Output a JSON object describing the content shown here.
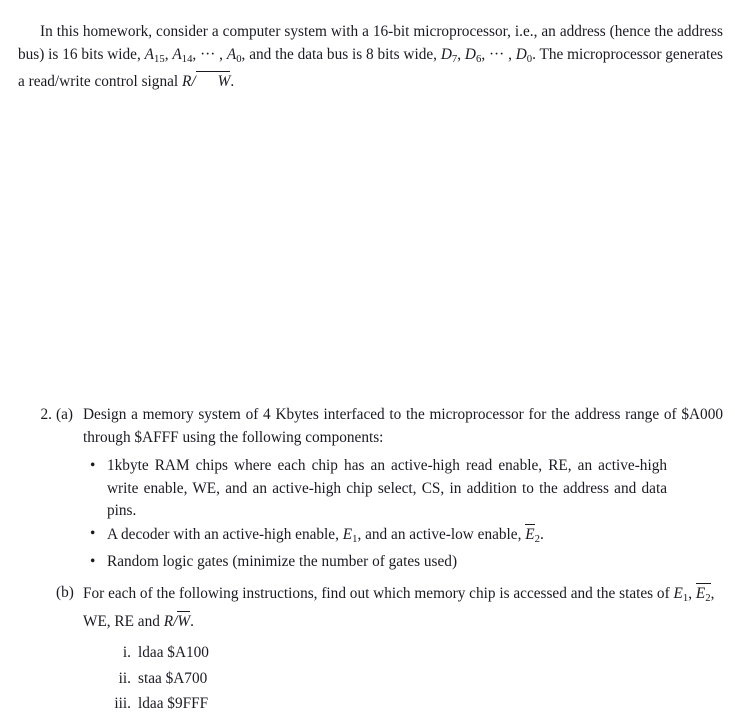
{
  "document": {
    "intro": {
      "text_plain": "In this homework, consider a computer system with a 16-bit microprocessor, i.e., an address (hence the address bus) is 16 bits wide, A15, A14, ···, A0, and the data bus is 8 bits wide, D7, D6, ···, D0. The microprocessor generates a read/write control signal R/W̄.",
      "seg1": "In this homework, consider a computer system with a 16-bit microprocessor, i.e., an address (hence the address bus) is 16 bits wide, ",
      "addr_msb": "A",
      "addr_msb_sub": "15",
      "comma1": ", ",
      "addr_next": "A",
      "addr_next_sub": "14",
      "ellipsis1": ", ··· , ",
      "addr_lsb": "A",
      "addr_lsb_sub": "0",
      "seg2": ", and the data bus is 8 bits wide, ",
      "data_msb": "D",
      "data_msb_sub": "7",
      "comma2": ", ",
      "data_next": "D",
      "data_next_sub": "6",
      "ellipsis2": ", ··· , ",
      "data_lsb": "D",
      "data_lsb_sub": "0",
      "seg3": ". The microprocessor generates a read/write control signal ",
      "rw_r": "R",
      "rw_slash": "/",
      "rw_w": "W",
      "period": "."
    },
    "problem": {
      "number": "2.",
      "parts": [
        {
          "label": "(a)",
          "text": "Design a memory system of 4 Kbytes interfaced to the microprocessor for the address range of $A000 through $AFFF using the following components:",
          "bullets": [
            {
              "marker": "•",
              "text": "1kbyte RAM chips where each chip has an active-high read enable, RE, an active-high write enable, WE, and an active-high chip select, CS, in addition to the address and data pins."
            },
            {
              "marker": "•",
              "prefix": "A decoder with an active-high enable, ",
              "e1": "E",
              "e1_sub": "1",
              "middle": ", and an active-low enable, ",
              "e2": "E",
              "e2_sub": "2",
              "suffix": "."
            },
            {
              "marker": "•",
              "text": "Random logic gates (minimize the number of gates used)"
            }
          ]
        },
        {
          "label": "(b)",
          "line1": "For each of the following instructions, find out which memory chip is accessed and",
          "line2_prefix": "the states of ",
          "e1": "E",
          "e1_sub": "1",
          "sep1": ", ",
          "e2": "E",
          "e2_sub": "2",
          "sep2": ", WE, RE and ",
          "rw_r": "R",
          "rw_slash": "/",
          "rw_w": "W",
          "end": ".",
          "items": [
            {
              "numeral": "i.",
              "instruction": "ldaa $A100"
            },
            {
              "numeral": "ii.",
              "instruction": "staa $A700"
            },
            {
              "numeral": "iii.",
              "instruction": "ldaa $9FFF"
            }
          ]
        }
      ]
    }
  },
  "colors": {
    "background": "#ffffff",
    "text": "#1a1a22"
  }
}
